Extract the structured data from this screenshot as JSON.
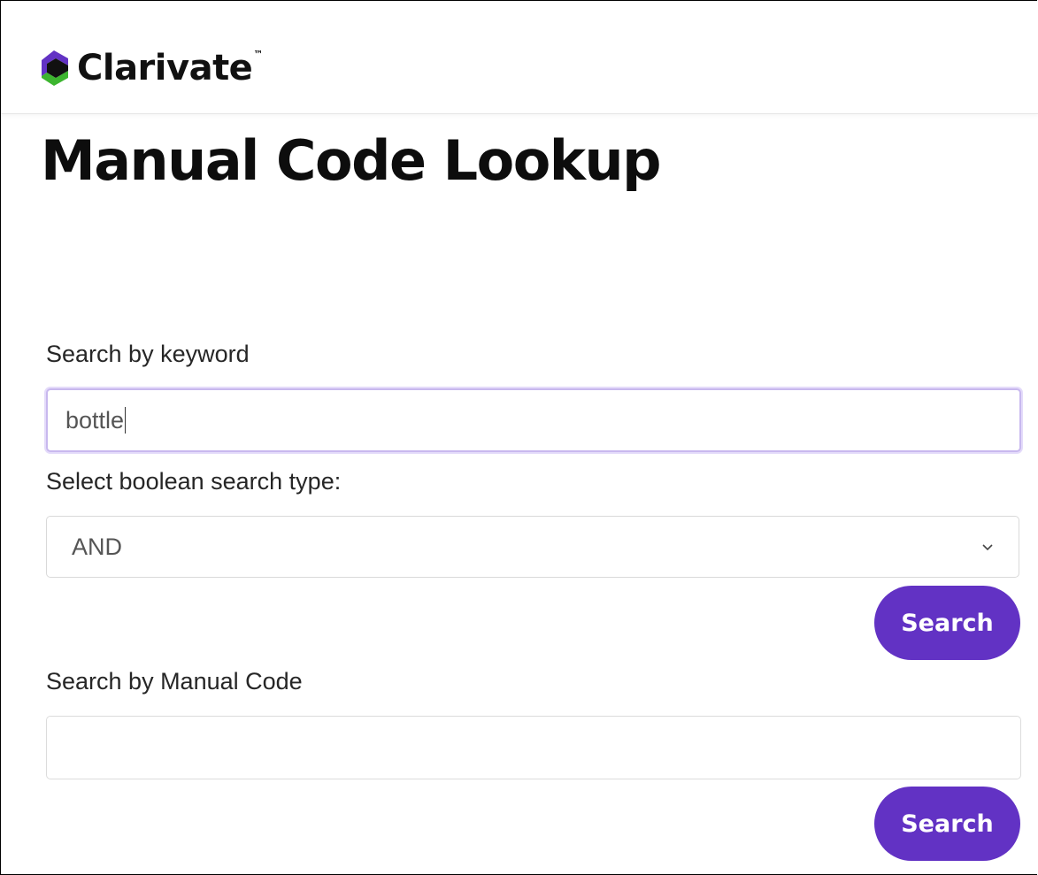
{
  "brand": {
    "name": "Clarivate",
    "trademark": "™",
    "logo_icon": "clarivate-logo-icon",
    "colors": {
      "purple": "#6232c4",
      "green": "#3cb52f"
    }
  },
  "page": {
    "title": "Manual Code Lookup"
  },
  "keyword_search": {
    "label": "Search by keyword",
    "value": "bottle",
    "boolean_label": "Select boolean search type:",
    "boolean_selected": "AND",
    "search_button": "Search"
  },
  "code_search": {
    "label": "Search by Manual Code",
    "value": "",
    "search_button": "Search"
  },
  "colors": {
    "button_bg": "#6232c4",
    "button_text": "#ffffff",
    "focus_border": "#c8b8ee"
  }
}
